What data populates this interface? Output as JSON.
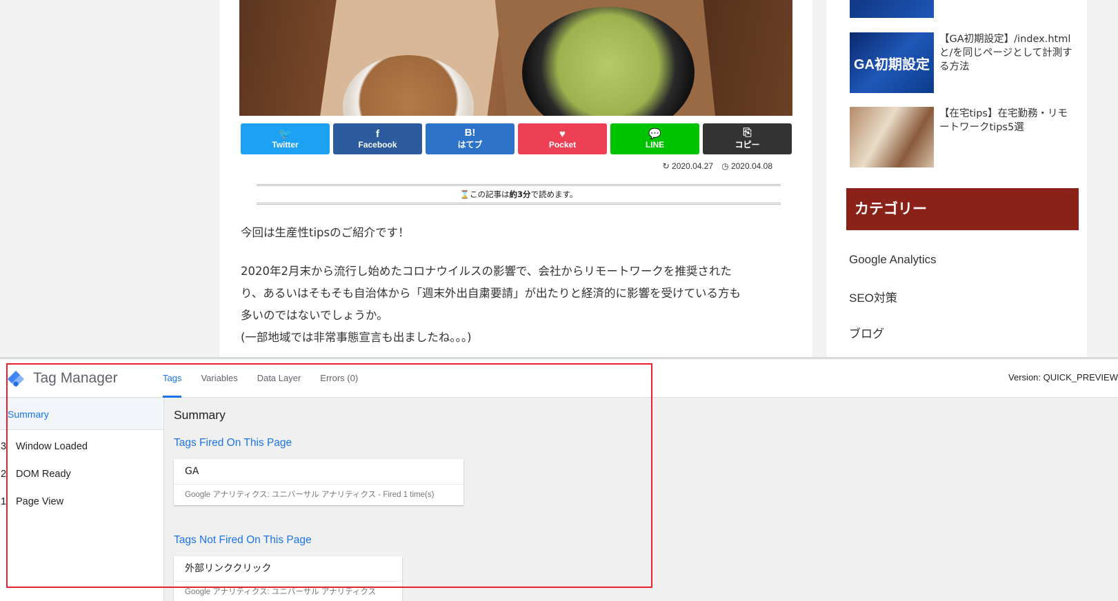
{
  "article": {
    "share": [
      {
        "id": "twitter",
        "icon": "🐦",
        "label": "Twitter"
      },
      {
        "id": "facebook",
        "icon": "f",
        "label": "Facebook"
      },
      {
        "id": "hatena",
        "icon": "B!",
        "label": "はてブ"
      },
      {
        "id": "pocket",
        "icon": "♥",
        "label": "Pocket"
      },
      {
        "id": "line",
        "icon": "💬",
        "label": "LINE"
      },
      {
        "id": "copy",
        "icon": "⎘",
        "label": "コピー"
      }
    ],
    "updated_date": "2020.04.27",
    "published_date": "2020.04.08",
    "read_time_prefix": "この記事は",
    "read_time_value": "約3分",
    "read_time_suffix": "で読めます。",
    "paragraph1": "今回は生産性tipsのご紹介です！",
    "paragraph2_line1": "2020年2月末から流行し始めたコロナウイルスの影響で、会社からリモートワークを推奨された",
    "paragraph2_line2": "り、あるいはそもそも自治体から「週末外出自粛要請」が出たりと経済的に影響を受けている方も",
    "paragraph2_line3": "多いのではないでしょうか。",
    "paragraph2_line4": "(一部地域では非常事態宣言も出ましたね。。。)"
  },
  "sidebar": {
    "related": [
      {
        "title": "【GA初期設定】/index.htmlと/を同じページとして計測する方法",
        "thumb_text": "GA初期設定"
      },
      {
        "title": "【在宅tips】在宅勤務・リモートワークtips5選"
      }
    ],
    "category_header": "カテゴリー",
    "categories": [
      "Google Analytics",
      "SEO対策",
      "ブログ"
    ]
  },
  "tag_manager": {
    "title": "Tag Manager",
    "tabs": [
      "Tags",
      "Variables",
      "Data Layer",
      "Errors (0)"
    ],
    "active_tab": "Tags",
    "version": "Version: QUICK_PREVIEW",
    "summary_link": "Summary",
    "events": [
      {
        "num": "3",
        "name": "Window Loaded"
      },
      {
        "num": "2",
        "name": "DOM Ready"
      },
      {
        "num": "1",
        "name": "Page View"
      }
    ],
    "main_title": "Summary",
    "fired_heading": "Tags Fired On This Page",
    "fired_tags": [
      {
        "name": "GA",
        "detail": "Google アナリティクス: ユニバーサル アナリティクス - Fired 1 time(s)"
      }
    ],
    "not_fired_heading": "Tags Not Fired On This Page",
    "not_fired_tags": [
      {
        "name": "外部リンククリック",
        "detail": "Google アナリティクス: ユニバーサル アナリティクス"
      }
    ]
  },
  "colors": {
    "tm_accent": "#1a73e8",
    "highlight_box": "#e8212c",
    "category_header": "#8b2219"
  }
}
